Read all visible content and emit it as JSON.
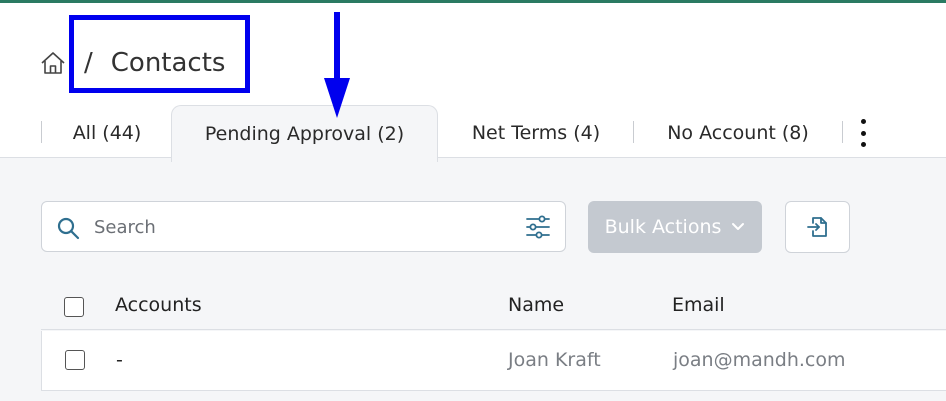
{
  "breadcrumb": {
    "separator": "/",
    "title": "Contacts"
  },
  "tabs": [
    {
      "label": "All (44)",
      "active": false
    },
    {
      "label": "Pending Approval (2)",
      "active": true
    },
    {
      "label": "Net Terms (4)",
      "active": false
    },
    {
      "label": "No Account (8)",
      "active": false
    }
  ],
  "toolbar": {
    "search_placeholder": "Search",
    "bulk_actions_label": "Bulk Actions"
  },
  "table": {
    "columns": [
      "Accounts",
      "Name",
      "Email"
    ],
    "rows": [
      {
        "account": "-",
        "name": "Joan Kraft",
        "email": "joan@mandh.com"
      }
    ]
  },
  "colors": {
    "top_accent": "#2a7a62",
    "annotation": "#0000ee",
    "bulk_button_disabled": "#c4c9d0"
  },
  "icons": [
    "home-icon",
    "search-icon",
    "filter-icon",
    "chevron-down-icon",
    "export-icon",
    "more-vertical-icon"
  ]
}
